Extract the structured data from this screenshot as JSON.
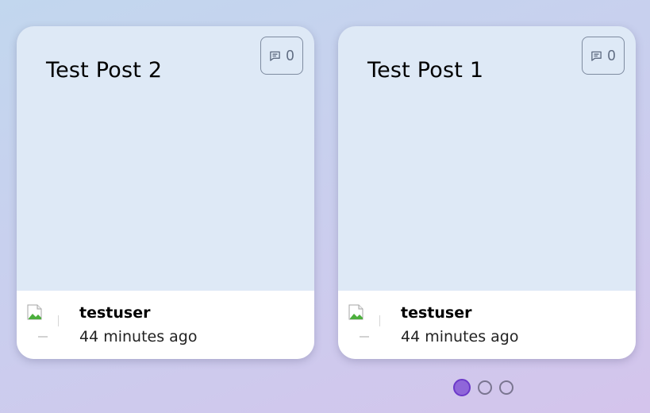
{
  "posts": [
    {
      "title": "Test Post 2",
      "comment_count": "0",
      "comment_icon": "message-square-icon",
      "username": "testuser",
      "timestamp": "44 minutes ago",
      "avatar_icon": "broken-image-icon"
    },
    {
      "title": "Test Post 1",
      "comment_count": "0",
      "comment_icon": "message-square-icon",
      "username": "testuser",
      "timestamp": "44 minutes ago",
      "avatar_icon": "broken-image-icon"
    }
  ],
  "pagination": {
    "pages": 3,
    "active_index": 0
  },
  "colors": {
    "card_body": "#dee9f6",
    "card_footer": "#ffffff",
    "active_dot": "#8f66d9",
    "inactive_dot_border": "#7a7590"
  }
}
